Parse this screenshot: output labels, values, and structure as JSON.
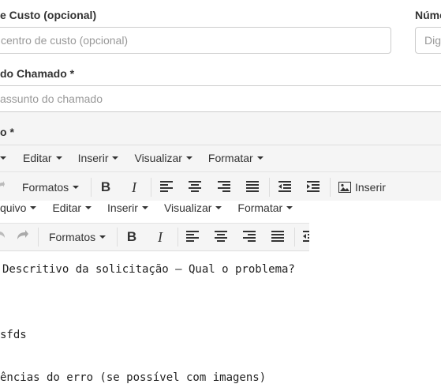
{
  "form": {
    "cost_center": {
      "label": "e Custo (opcional)",
      "placeholder": "centro de custo (opcional)"
    },
    "number": {
      "label": "Núme",
      "placeholder": "Dig"
    },
    "subject": {
      "label": "do Chamado *",
      "placeholder": "assunto do chamado"
    },
    "description": {
      "label": "o *"
    }
  },
  "outer_editor": {
    "menu": [
      "Editar",
      "Inserir",
      "Visualizar",
      "Formatar"
    ],
    "toolbar": {
      "formats": "Formatos",
      "bold": "B",
      "italic": "I",
      "insert": "Inserir"
    }
  },
  "inner_editor": {
    "menu": [
      "quivo",
      "Editar",
      "Inserir",
      "Visualizar",
      "Formatar"
    ],
    "toolbar": {
      "formats": "Formatos",
      "bold": "B",
      "italic": "I"
    },
    "content": {
      "line1": "Descritivo da solicitação – Qual o problema?",
      "line2": "sfds",
      "line3": "ências do erro (se possível com imagens)"
    }
  },
  "icons": [
    "undo-icon",
    "redo-icon",
    "align-left-icon",
    "align-center-icon",
    "align-right-icon",
    "align-justify-icon",
    "outdent-icon",
    "indent-icon",
    "image-icon"
  ]
}
